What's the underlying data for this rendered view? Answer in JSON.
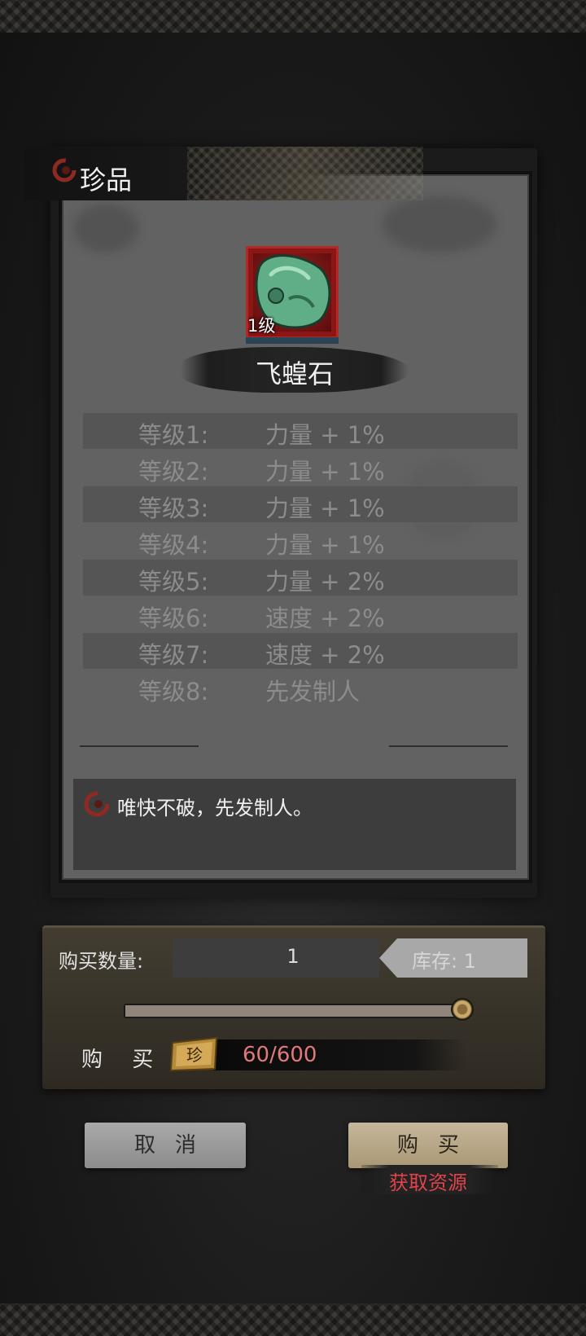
{
  "header": {
    "title": "珍品",
    "logo_icon": "red-swirl-logo"
  },
  "item": {
    "level_badge": "1级",
    "name": "飞蝗石",
    "icon": "green-jade-stone-icon",
    "frame_color": "#8c1515"
  },
  "levels": [
    {
      "label": "等级1:",
      "value": "力量 + 1%"
    },
    {
      "label": "等级2:",
      "value": "力量 + 1%"
    },
    {
      "label": "等级3:",
      "value": "力量 + 1%"
    },
    {
      "label": "等级4:",
      "value": "力量 + 1%"
    },
    {
      "label": "等级5:",
      "value": "力量 + 2%"
    },
    {
      "label": "等级6:",
      "value": "速度 + 2%"
    },
    {
      "label": "等级7:",
      "value": "速度 + 2%"
    },
    {
      "label": "等级8:",
      "value": "先发制人"
    }
  ],
  "description": "唯快不破，先发制人。",
  "purchase": {
    "quantity_label": "购买数量:",
    "quantity_value": "1",
    "stock_text": "库存: 1",
    "slider_fraction": 1.0,
    "buy_label": "购 买",
    "currency_icon": "zhen-token-icon",
    "currency_char": "珍",
    "cost_text": "60/600",
    "cost_color": "#e07a7a"
  },
  "buttons": {
    "cancel": "取消",
    "buy": "购买",
    "get_resources": "获取资源"
  }
}
